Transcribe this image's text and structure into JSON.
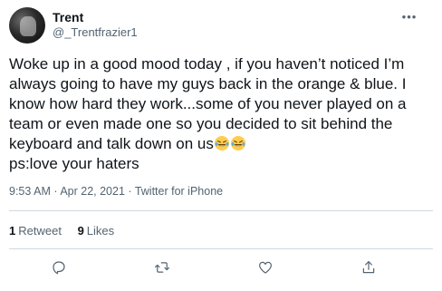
{
  "author": {
    "display_name": "Trent",
    "handle": "@_Trentfrazier1"
  },
  "more_label": "•••",
  "tweet": {
    "text_main": "Woke up in a good mood today , if you haven’t noticed I’m always going to have my guys back in the orange & blue. I know how hard they work...some of you never played on a team or even made one so you decided to sit behind the keyboard and talk down on us",
    "emoji_name": "rolling-on-floor-laughing-emoji",
    "emoji_count": 2,
    "text_end": "ps:love your haters"
  },
  "meta": {
    "time": "9:53 AM",
    "date": "Apr 22, 2021",
    "source": "Twitter for iPhone",
    "separator": "·"
  },
  "stats": {
    "retweets_count": "1",
    "retweets_label": "Retweet",
    "likes_count": "9",
    "likes_label": "Likes"
  },
  "actions": {
    "reply_icon": "reply-icon",
    "retweet_icon": "retweet-icon",
    "like_icon": "heart-icon",
    "share_icon": "share-icon"
  },
  "colors": {
    "text": "#0f1419",
    "secondary": "#536471",
    "divider": "#cfd9de"
  }
}
